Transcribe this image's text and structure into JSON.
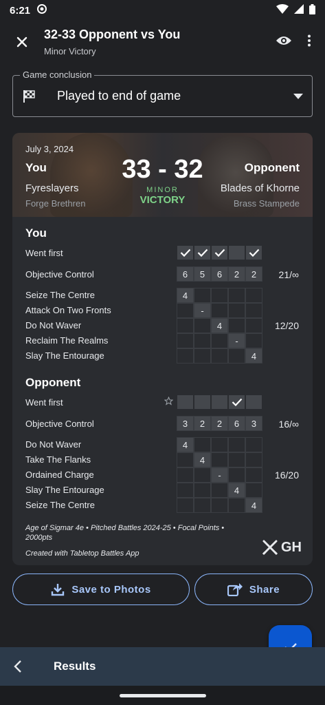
{
  "status": {
    "time": "6:21"
  },
  "appbar": {
    "title": "32-33 Opponent vs You",
    "subtitle": "Minor Victory"
  },
  "conclusion": {
    "legend": "Game conclusion",
    "value": "Played to end of game"
  },
  "banner": {
    "date": "July 3, 2024",
    "you_label": "You",
    "opp_label": "Opponent",
    "score_you": "33",
    "score_sep": "-",
    "score_opp": "32",
    "result_minor": "MINOR",
    "result_main": "VICTORY",
    "you_faction": "Fyreslayers",
    "you_subfaction": "Forge Brethren",
    "opp_faction": "Blades of Khorne",
    "opp_subfaction": "Brass Stampede"
  },
  "you": {
    "title": "You",
    "went_first_label": "Went first",
    "went_first": [
      true,
      true,
      true,
      false,
      true
    ],
    "oc_label": "Objective Control",
    "oc": [
      "6",
      "5",
      "6",
      "2",
      "2"
    ],
    "oc_total": "21/∞",
    "tactics": [
      {
        "name": "Seize The Centre",
        "round": 1,
        "value": "4"
      },
      {
        "name": "Attack On Two Fronts",
        "round": 2,
        "value": "-"
      },
      {
        "name": "Do Not Waver",
        "round": 3,
        "value": "4"
      },
      {
        "name": "Reclaim The Realms",
        "round": 4,
        "value": "-"
      },
      {
        "name": "Slay The Entourage",
        "round": 5,
        "value": "4"
      }
    ],
    "tactics_total": "12/20"
  },
  "opponent": {
    "title": "Opponent",
    "went_first_label": "Went first",
    "went_first": [
      false,
      false,
      false,
      true,
      false
    ],
    "oc_label": "Objective Control",
    "oc": [
      "3",
      "2",
      "2",
      "6",
      "3"
    ],
    "oc_total": "16/∞",
    "tactics": [
      {
        "name": "Do Not Waver",
        "round": 1,
        "value": "4"
      },
      {
        "name": "Take The Flanks",
        "round": 2,
        "value": "4"
      },
      {
        "name": "Ordained Charge",
        "round": 3,
        "value": "-"
      },
      {
        "name": "Slay The Entourage",
        "round": 4,
        "value": "4"
      },
      {
        "name": "Seize The Centre",
        "round": 5,
        "value": "4"
      }
    ],
    "tactics_total": "16/20"
  },
  "footer": {
    "note": "Age of Sigmar 4e • Pitched Battles 2024-25 • Focal Points • 2000pts",
    "created": "Created with Tabletop Battles App",
    "logo_text": "GH"
  },
  "actions": {
    "save_label": "Save to Photos",
    "share_label": "Share"
  },
  "bottom": {
    "label": "Results"
  },
  "colors": {
    "accent": "#8ab4f8",
    "victory": "#7ed389",
    "fab": "#0b57d0"
  }
}
